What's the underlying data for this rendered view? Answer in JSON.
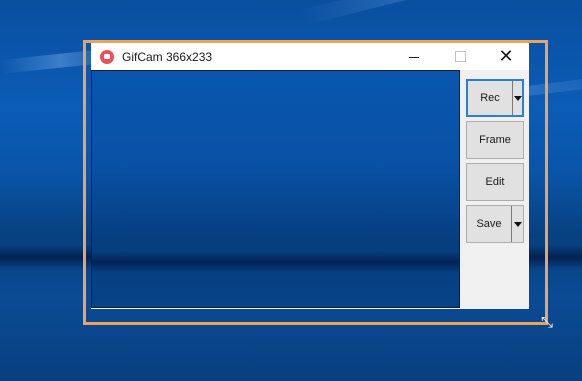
{
  "window": {
    "title": "GifCam 366x233"
  },
  "icons": {
    "app": "gifcam-app-icon",
    "minimize": "minimize-icon",
    "maximize": "maximize-icon",
    "close": "close-icon",
    "dropdown": "chevron-down-icon",
    "resize": "resize-diagonal-icon"
  },
  "controls": {
    "close_glyph": "✕",
    "rec_label": "Rec",
    "frame_label": "Frame",
    "edit_label": "Edit",
    "save_label": "Save"
  },
  "colors": {
    "capture_border": "#f0a15a",
    "rec_focus": "#2a7fd4",
    "desktop": "#0a4fa0"
  }
}
